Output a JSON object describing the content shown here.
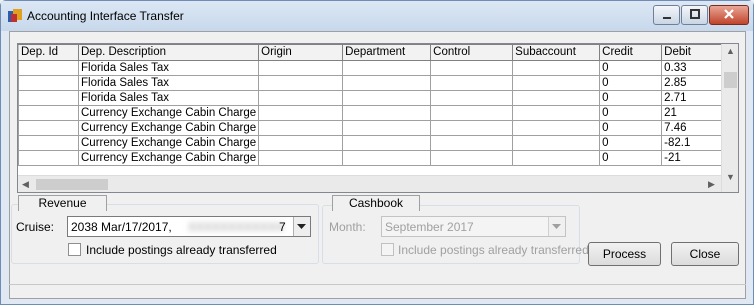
{
  "window": {
    "title": "Accounting Interface Transfer",
    "buttons": {
      "minimize": "minimize-icon",
      "maximize": "maximize-icon",
      "close": "close-icon"
    }
  },
  "grid": {
    "columns": [
      "Dep. Id",
      "Dep. Description",
      "Origin",
      "Department",
      "Control",
      "Subaccount",
      "Credit",
      "Debit"
    ],
    "rows": [
      {
        "dep_id": "",
        "description": "Florida Sales Tax",
        "origin": "",
        "department": "",
        "control": "",
        "subaccount": "",
        "credit": "0",
        "debit": "0.33"
      },
      {
        "dep_id": "",
        "description": "Florida Sales Tax",
        "origin": "",
        "department": "",
        "control": "",
        "subaccount": "",
        "credit": "0",
        "debit": "2.85"
      },
      {
        "dep_id": "",
        "description": "Florida Sales Tax",
        "origin": "",
        "department": "",
        "control": "",
        "subaccount": "",
        "credit": "0",
        "debit": "2.71"
      },
      {
        "dep_id": "",
        "description": "Currency Exchange Cabin Charge",
        "origin": "",
        "department": "",
        "control": "",
        "subaccount": "",
        "credit": "0",
        "debit": "21"
      },
      {
        "dep_id": "",
        "description": "Currency Exchange Cabin Charge",
        "origin": "",
        "department": "",
        "control": "",
        "subaccount": "",
        "credit": "0",
        "debit": "7.46"
      },
      {
        "dep_id": "",
        "description": "Currency Exchange Cabin Charge",
        "origin": "",
        "department": "",
        "control": "",
        "subaccount": "",
        "credit": "0",
        "debit": "-82.1"
      },
      {
        "dep_id": "",
        "description": "Currency Exchange Cabin Charge",
        "origin": "",
        "department": "",
        "control": "",
        "subaccount": "",
        "credit": "0",
        "debit": "-21"
      }
    ]
  },
  "revenue": {
    "tab_label": "Revenue",
    "cruise_label": "Cruise:",
    "cruise_value": "2038     Mar/17/2017,",
    "cruise_value_tail": "7",
    "include_label": "Include postings already transferred",
    "include_checked": false
  },
  "cashbook": {
    "tab_label": "Cashbook",
    "month_label": "Month:",
    "month_value": "September 2017",
    "include_label": "Include postings already transferred",
    "include_checked": false
  },
  "actions": {
    "process_label": "Process",
    "close_label": "Close"
  }
}
